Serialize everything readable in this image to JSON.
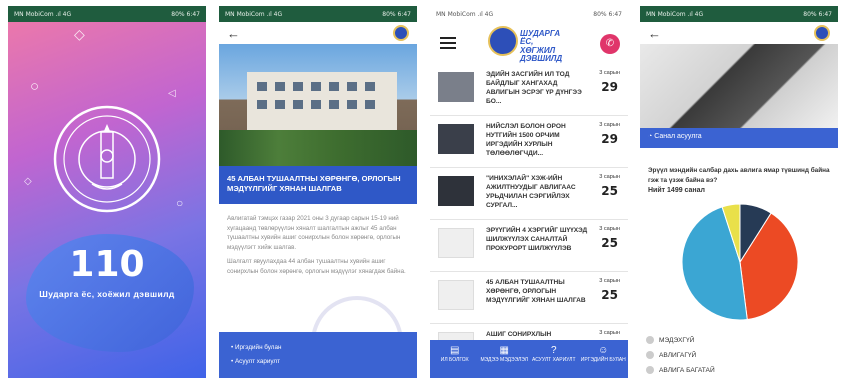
{
  "status": {
    "left": "MN MobiCom .ıl 4G",
    "right": "80% 6:47"
  },
  "screen1": {
    "number": "110",
    "tagline": "Шударга ёс, хоёжил дэвшилд"
  },
  "screen2": {
    "headline": "45 АЛБАН ТУШААЛТНЫ ХӨРӨНГӨ, ОРЛОГЫН МЭДҮҮЛГИЙГ ХЯНАН ШАЛГАВ",
    "para1": "Авлигатай тэмцэх газар 2021 оны 3 дугаар сарын 15-19 ний хугацаанд төвлөрүүлэн хяналт шалгалтын ажлыг 45 албан тушаалтны хувийн ашиг сонирхлын болон хөрөнгө, орлогын мэдүүлэгт хийж шалгав.",
    "para2": "Шалгалт явуулахдаа 44 албан тушаалтны хувийн ашиг сонирхлын болон хөрөнгө, орлогын мэдүүлэг хянагдаж байна.",
    "footer_items": [
      "Иргэдийн булан",
      "Асуулт хариулт"
    ]
  },
  "screen3": {
    "logo_text": [
      "ШУДАРГА ЁС,",
      "ХӨГЖИЛ",
      "ДЭВШИЛД"
    ],
    "news": [
      {
        "title": "ЭДИЙН ЗАСГИЙН ИЛ ТОД БАЙДЛЫГ ХАНГАХАД АВЛИГЫН ЭСРЭГ ҮР ДҮНГЭЭ БО...",
        "month": "3 сарын",
        "day": "29"
      },
      {
        "title": "НИЙСЛЭЛ БОЛОН ОРОН НУТГИЙН 1500 ОРЧИМ ИРГЭДИЙН ХУРЛЫН ТӨЛӨӨЛӨГЧДИ...",
        "month": "3 сарын",
        "day": "29"
      },
      {
        "title": "\"ИНИХЭЛАЙ\" ХЭЖ-ИЙН АЖИЛТНУУДЫГ АВЛИГААС УРЬДЧИЛАН СЭРГИЙЛЭХ СУРГАЛ...",
        "month": "3 сарын",
        "day": "25"
      },
      {
        "title": "ЭРҮҮГИЙН 4 ХЭРГИЙГ ШҮҮХЭД ШИЛЖҮҮЛЭХ САНАЛТАЙ ПРОКУРОРТ ШИЛЖҮҮЛЭВ",
        "month": "3 сарын",
        "day": "25"
      },
      {
        "title": "45 АЛБАН ТУШААЛТНЫ ХӨРӨНГӨ, ОРЛОГЫН МЭДҮҮЛГИЙГ ХЯНАН ШАЛГАВ",
        "month": "3 сарын",
        "day": "25"
      },
      {
        "title": "АШИГ СОНИРХЛЫН",
        "month": "3 сарын",
        "day": ""
      }
    ],
    "tabs": [
      {
        "label": "ИЛ БОЛГОХ",
        "icon": "report-icon"
      },
      {
        "label": "МЭДЭЭ МЭДЭЭЛЭЛ",
        "icon": "news-icon"
      },
      {
        "label": "АСУУЛТ ХАРИУЛТ",
        "icon": "help-icon"
      },
      {
        "label": "ИРГЭДИЙН БУЛАН",
        "icon": "people-icon"
      }
    ]
  },
  "screen4": {
    "bar_title": "Санал асуулга",
    "question": "Эрүүл мэндийн салбар дахь авлига ямар түвшинд байна гэж та үзэж байна вэ?",
    "total": "Нийт 1499 санал",
    "options": [
      "МЭДЭХГҮЙ",
      "АВЛИГАГҮЙ",
      "АВЛИГА БАГАТАЙ"
    ]
  },
  "chart_data": {
    "type": "pie",
    "categories": [
      "",
      "",
      "",
      ""
    ],
    "values": [
      39,
      47,
      5,
      9
    ],
    "colors": [
      "#ec4a24",
      "#3ba6d3",
      "#e9e04a",
      "#263a55"
    ]
  }
}
